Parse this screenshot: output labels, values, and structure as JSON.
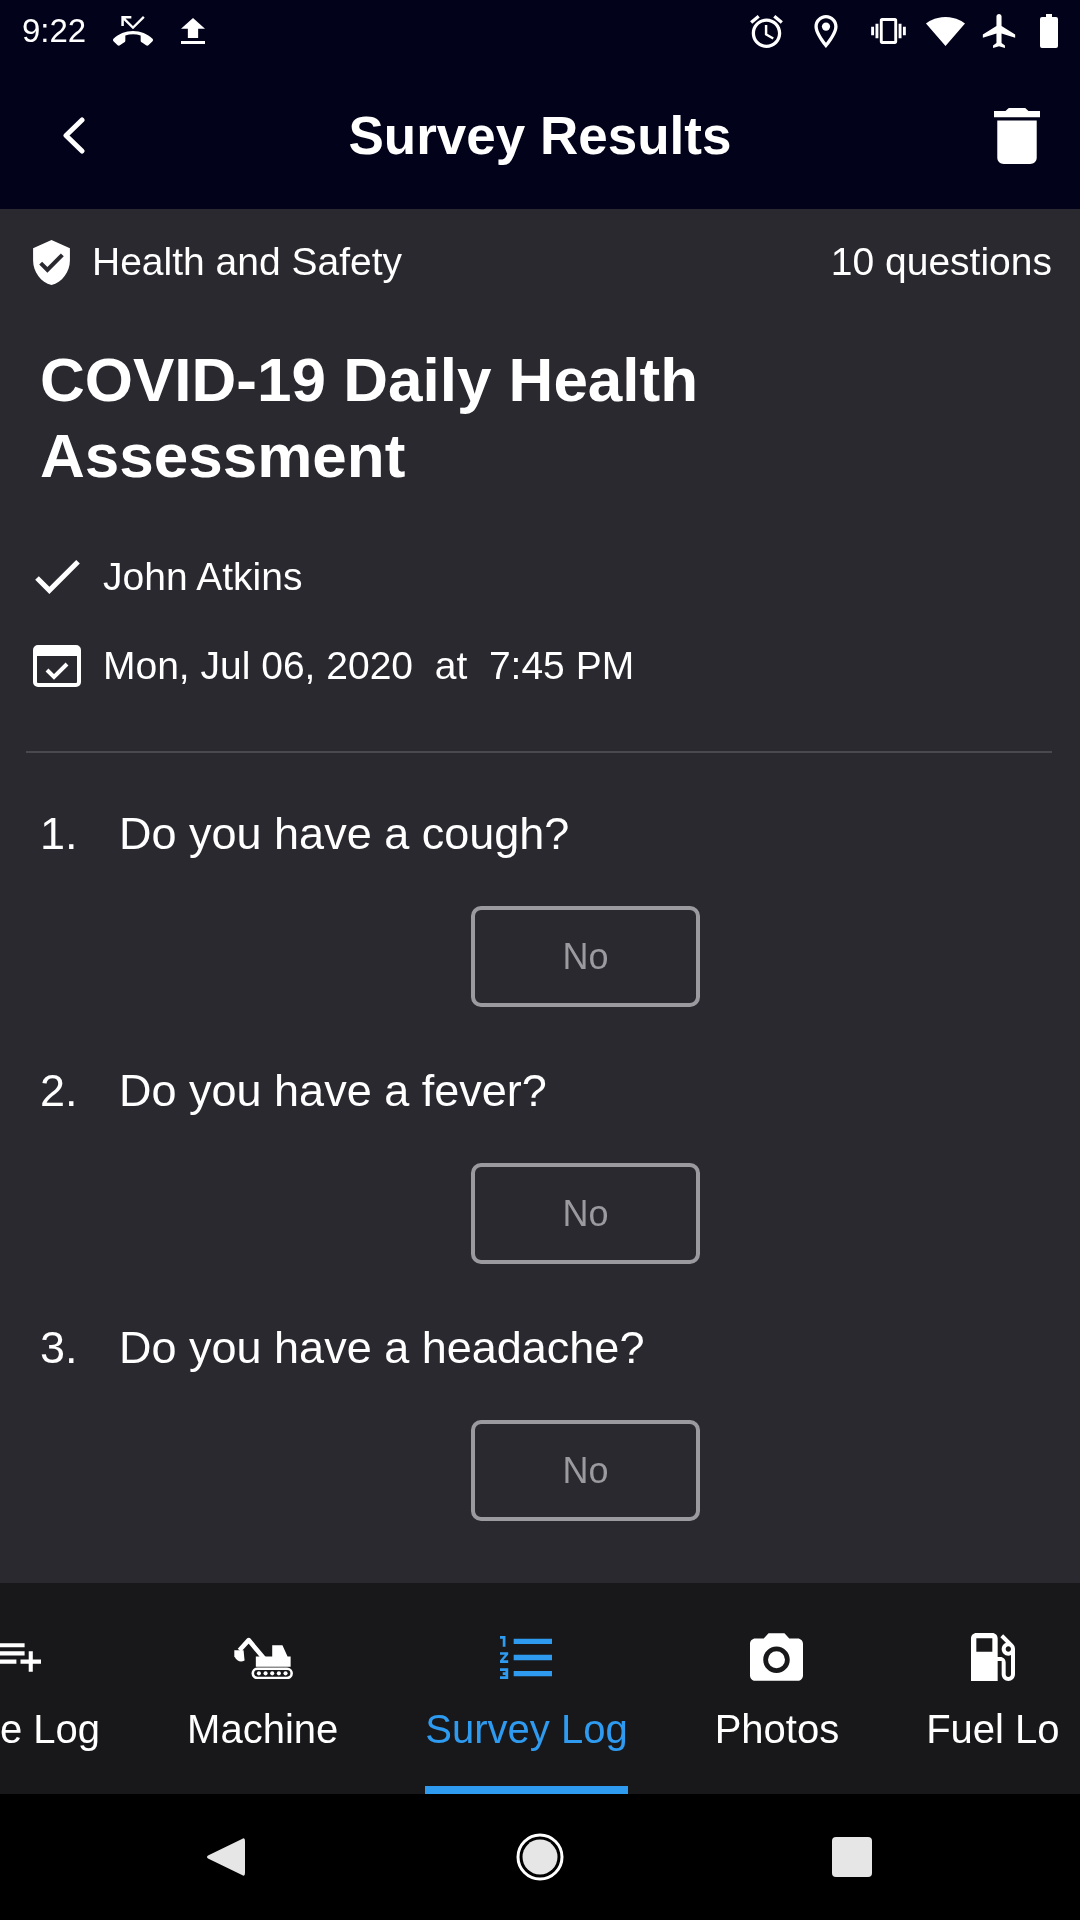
{
  "status_bar": {
    "time": "9:22"
  },
  "app_bar": {
    "title": "Survey Results"
  },
  "survey": {
    "category": "Health and Safety",
    "question_count": "10 questions",
    "title": "COVID-19 Daily Health Assessment",
    "respondent": "John Atkins",
    "submitted": "Mon, Jul 06, 2020  at  7:45 PM"
  },
  "questions": [
    {
      "number": "1.",
      "text": "Do you have a cough?",
      "answer": "No"
    },
    {
      "number": "2.",
      "text": "Do you have a fever?",
      "answer": "No"
    },
    {
      "number": "3.",
      "text": "Do you have a headache?",
      "answer": "No"
    }
  ],
  "bottom_tabs": [
    {
      "label": "e Log",
      "selected": false
    },
    {
      "label": "Machine",
      "selected": false
    },
    {
      "label": "Survey Log",
      "selected": true
    },
    {
      "label": "Photos",
      "selected": false
    },
    {
      "label": "Fuel Lo",
      "selected": false
    }
  ]
}
